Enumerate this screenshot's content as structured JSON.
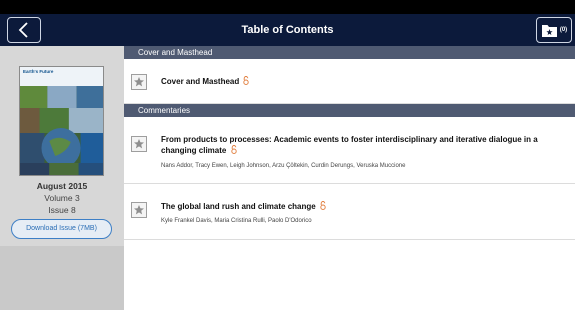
{
  "header": {
    "title": "Table of Contents",
    "saved_count": "(0)"
  },
  "issue": {
    "journal_title": "Earth's Future",
    "date": "August 2015",
    "volume": "Volume 3",
    "issue": "Issue 8",
    "download_label": "Download Issue (7MB)"
  },
  "sections": [
    {
      "title": "Cover and Masthead",
      "articles": [
        {
          "title": "Cover and Masthead",
          "authors": ""
        }
      ]
    },
    {
      "title": "Commentaries",
      "articles": [
        {
          "title": "From products to processes: Academic events to foster interdisciplinary and iterative dialogue in a changing climate",
          "authors": "Nans Addor, Tracy Ewen, Leigh Johnson, Arzu Çöltekin, Curdin Derungs, Veruska Muccione"
        },
        {
          "title": "The global land rush and climate change",
          "authors": "Kyle Frankel Davis, Maria Cristina Rulli, Paolo D'Odorico"
        }
      ]
    }
  ],
  "colors": {
    "header_bg": "#0c1a3b",
    "section_header_bg": "#4f5a72",
    "accent": "#2a6db5",
    "open_access": "#e07b39"
  },
  "icons": {
    "back": "chevron-left-icon",
    "saved": "folder-star-icon",
    "bookmark": "star-icon",
    "open_access": "open-access-lock-icon"
  }
}
